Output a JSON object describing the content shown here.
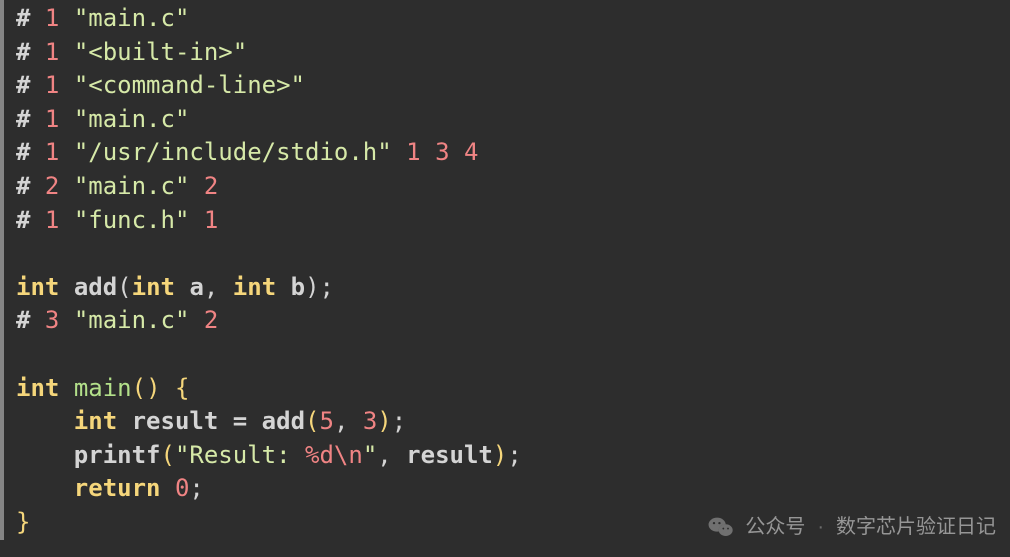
{
  "code": {
    "lines": [
      {
        "type": "pp",
        "num": "1",
        "str": "\"main.c\""
      },
      {
        "type": "pp",
        "num": "1",
        "str": "\"<built-in>\""
      },
      {
        "type": "pp",
        "num": "1",
        "str": "\"<command-line>\""
      },
      {
        "type": "pp",
        "num": "1",
        "str": "\"main.c\""
      },
      {
        "type": "pp",
        "num": "1",
        "str": "\"/usr/include/stdio.h\"",
        "trail_nums": [
          "1",
          "3",
          "4"
        ]
      },
      {
        "type": "pp",
        "num": "2",
        "str": "\"main.c\"",
        "trail_nums": [
          "2"
        ]
      },
      {
        "type": "pp",
        "num": "1",
        "str": "\"func.h\"",
        "trail_nums": [
          "1"
        ]
      },
      {
        "type": "blank"
      },
      {
        "type": "decl",
        "ret": "int",
        "name": "add",
        "params": [
          {
            "t": "int",
            "n": "a"
          },
          {
            "t": "int",
            "n": "b"
          }
        ]
      },
      {
        "type": "pp",
        "num": "3",
        "str": "\"main.c\"",
        "trail_nums": [
          "2"
        ]
      },
      {
        "type": "blank"
      },
      {
        "type": "funcopen",
        "ret": "int",
        "name": "main"
      },
      {
        "type": "assign",
        "indent": "    ",
        "vtype": "int",
        "vname": "result",
        "call": "add",
        "args_num": [
          "5",
          "3"
        ]
      },
      {
        "type": "printf",
        "indent": "    ",
        "text_pre": "\"Result: ",
        "fmt": "%d",
        "esc": "\\n",
        "text_post": "\"",
        "arg": "result"
      },
      {
        "type": "return",
        "indent": "    ",
        "val": "0"
      },
      {
        "type": "brace_close"
      }
    ]
  },
  "watermark": {
    "label": "公众号",
    "sep": "·",
    "name": "数字芯片验证日记"
  }
}
